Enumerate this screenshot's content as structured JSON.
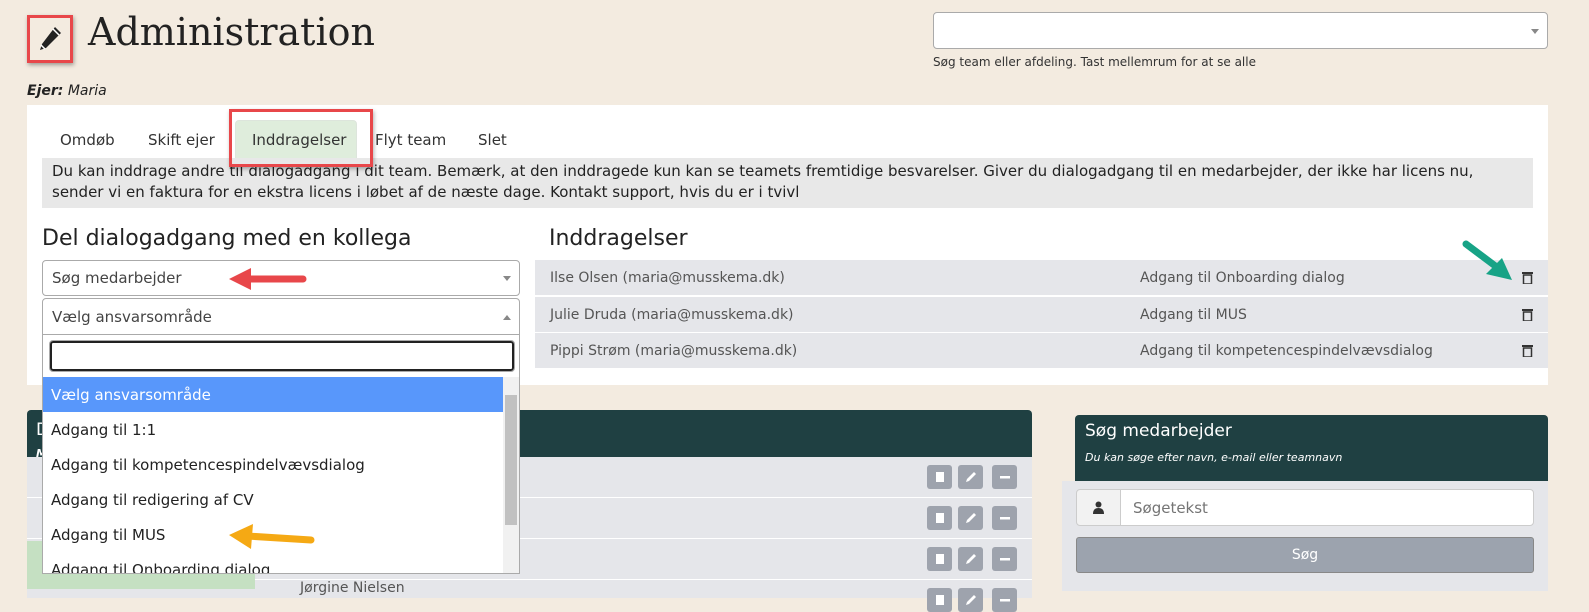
{
  "header": {
    "title": "Administration",
    "icon": "pencil-icon",
    "owner_label": "Ejer:",
    "owner_name": "Maria"
  },
  "team_search": {
    "value": "",
    "hint": "Søg team eller afdeling. Tast mellemrum for at se alle"
  },
  "tabs": [
    {
      "label": "Omdøb"
    },
    {
      "label": "Skift ejer"
    },
    {
      "label": "Inddragelser",
      "active": true
    },
    {
      "label": "Flyt team"
    },
    {
      "label": "Slet"
    }
  ],
  "info_text": "Du kan inddrage andre til dialogadgang i dit team. Bemærk, at den inddragede kun kan se teamets fremtidige besvarelser. Giver du dialogadgang til en medarbejder, der ikke har licens nu, sender vi en faktura for en ekstra licens i løbet af de næste dage. Kontakt support, hvis du er i tvivl",
  "share": {
    "heading": "Del dialogadgang med en kollega",
    "employee_select": "Søg medarbejder",
    "area_select": "Vælg ansvarsområde",
    "dropdown_search": "",
    "options": [
      "Vælg ansvarsområde",
      "Adgang til 1:1",
      "Adgang til kompetencespindelvævsdialog",
      "Adgang til redigering af CV",
      "Adgang til MUS",
      "Adgang til Onboarding dialog"
    ],
    "highlighted_index": 0
  },
  "involvements": {
    "heading": "Inddragelser",
    "rows": [
      {
        "person": "Ilse Olsen (maria@musskema.dk)",
        "access": "Adgang til Onboarding dialog"
      },
      {
        "person": "Julie Druda (maria@musskema.dk)",
        "access": "Adgang til MUS"
      },
      {
        "person": "Pippi Strøm (maria@musskema.dk)",
        "access": "Adgang til kompetencespindelvævsdialog"
      }
    ]
  },
  "members_panel": {
    "title_visible": "D",
    "subtitle_visible": "M",
    "last_row_name": "Jørgine Nielsen"
  },
  "employee_search": {
    "title": "Søg medarbejder",
    "subtitle": "Du kan søge efter navn, e-mail eller teamnavn",
    "placeholder": "Søgetekst",
    "button": "Søg"
  },
  "colors": {
    "background": "#f3ebe0",
    "header_dark": "#1f4042",
    "active_tab": "#dfeddc",
    "highlight": "#5897fb",
    "annotation_red": "#e8474a",
    "annotation_orange": "#f5a914",
    "annotation_green": "#17a386"
  }
}
